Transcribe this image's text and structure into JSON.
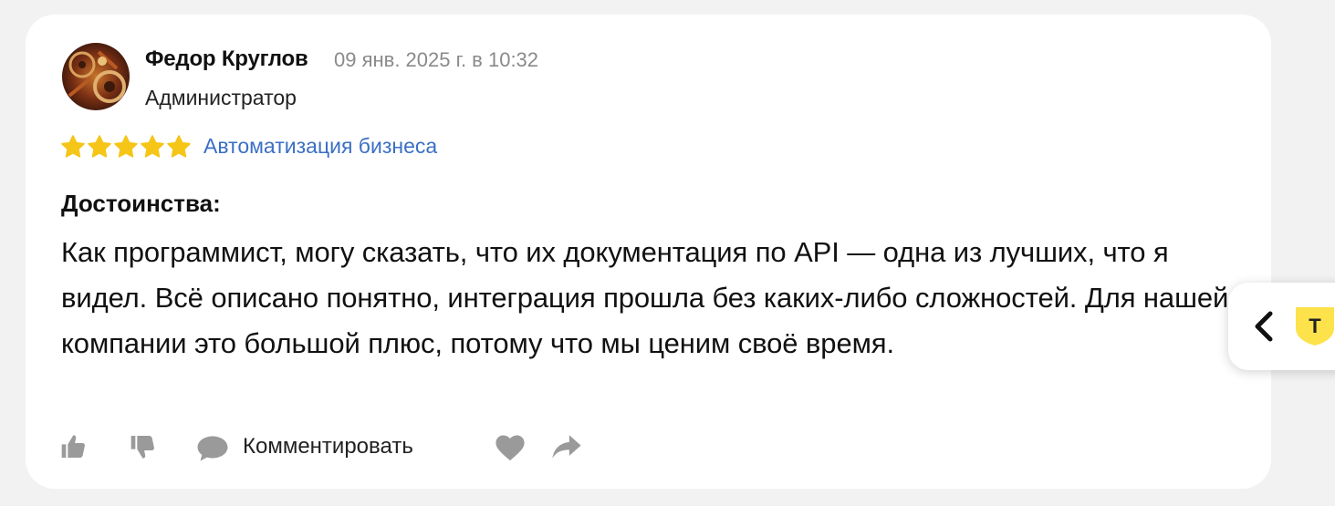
{
  "review": {
    "author": {
      "name": "Федор Круглов",
      "date": "09 янв. 2025 г. в 10:32",
      "role": "Администратор",
      "avatar_icon": "avatar-photo"
    },
    "rating": {
      "value": 5,
      "max": 5,
      "color": "#f5c518"
    },
    "category": "Автоматизация бизнеса",
    "section_title": "Достоинства:",
    "text": "Как программист, могу сказать, что их документация по API — одна из лучших, что я видел. Всё описано понятно, интеграция прошла без каких-либо сложностей. Для нашей компании это большой плюс, потому что мы ценим своё время.",
    "actions": {
      "comment_label": "Комментировать",
      "icons": [
        "thumb-up-icon",
        "thumb-down-icon",
        "comment-icon",
        "heart-icon",
        "share-icon"
      ]
    }
  },
  "side_tab": {
    "icons": [
      "chevron-left-icon",
      "t-badge-icon"
    ],
    "badge_letter": "T",
    "badge_color": "#fde24b"
  },
  "colors": {
    "link": "#3a6fc4",
    "page_bg": "#f2f2f2",
    "icon_gray": "#9a9a9a"
  }
}
